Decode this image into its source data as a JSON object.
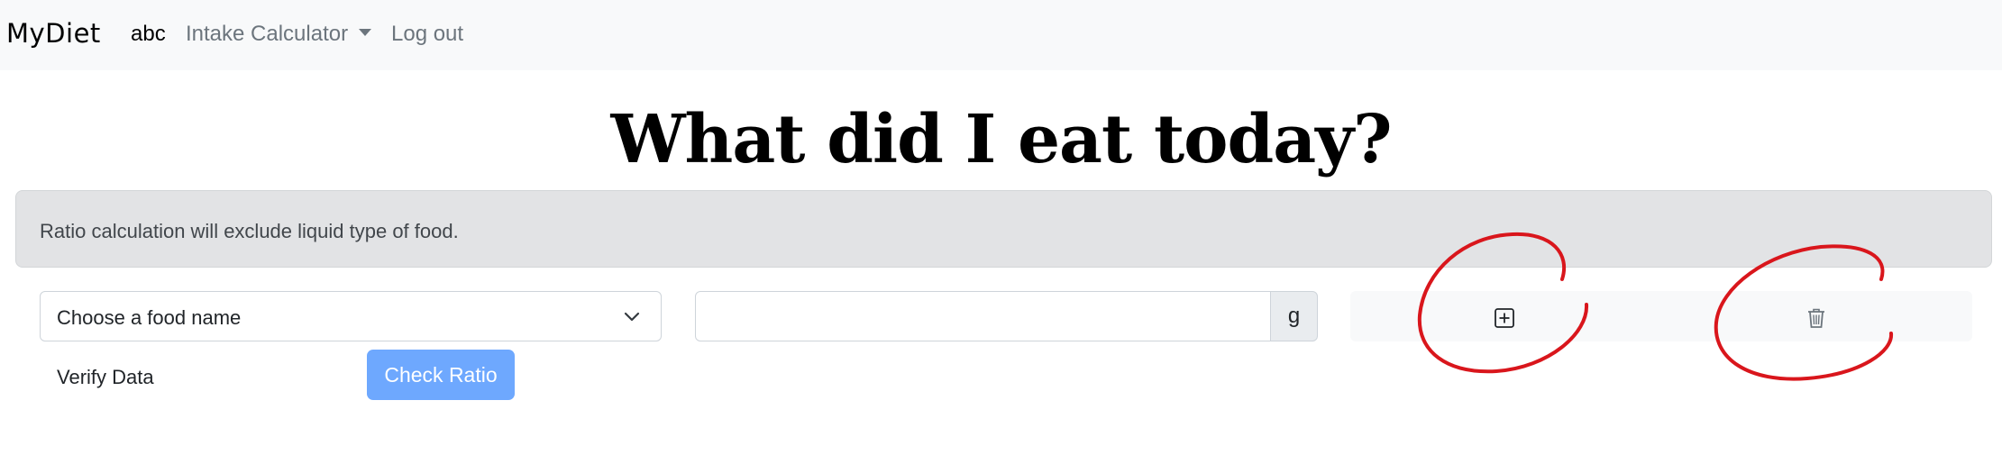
{
  "navbar": {
    "brand": "MyDiet",
    "user": "abc",
    "calculator": "Intake Calculator",
    "logout": "Log out"
  },
  "page": {
    "title": "What did I eat today?"
  },
  "alert": {
    "text": "Ratio calculation will exclude liquid type of food."
  },
  "form": {
    "food_select_value": "Choose a food name",
    "quantity_value": "",
    "unit": "g",
    "add_icon": "plus-square-icon",
    "delete_icon": "trash-icon",
    "verify_label": "Verify Data",
    "check_button": "Check Ratio"
  },
  "colors": {
    "navbar_bg": "#f8f9fa",
    "alert_bg": "#e2e3e5",
    "primary_button": "#6ea8fe",
    "annotation_red": "#d9161c"
  }
}
